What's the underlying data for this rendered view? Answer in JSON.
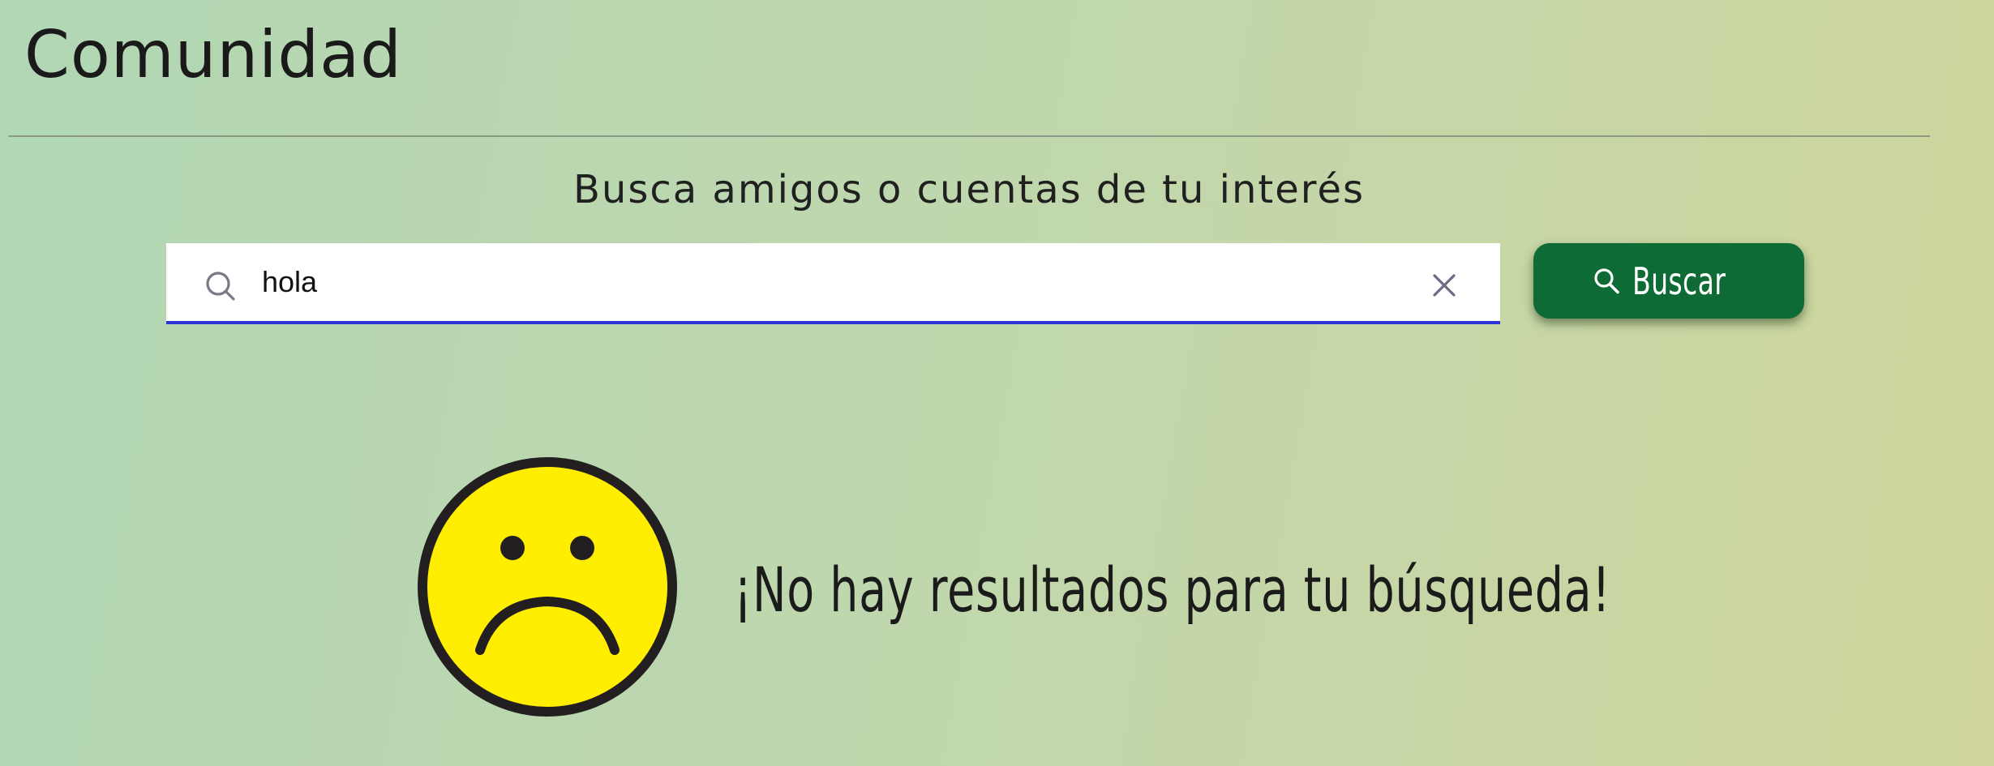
{
  "page": {
    "title": "Comunidad"
  },
  "search": {
    "subtitle": "Busca amigos o cuentas de tu interés",
    "value": "hola",
    "placeholder": "",
    "button_label": "Buscar"
  },
  "results": {
    "empty_message": "¡No hay resultados para tu búsqueda!"
  },
  "icons": {
    "search": "search-icon",
    "clear": "close-icon",
    "button": "magnifier-icon",
    "empty_state": "sad-face-icon"
  },
  "colors": {
    "button_bg": "#0f6b35",
    "input_underline": "#2f34d6",
    "face_yellow": "#ffee00",
    "face_outline": "#231f20"
  }
}
